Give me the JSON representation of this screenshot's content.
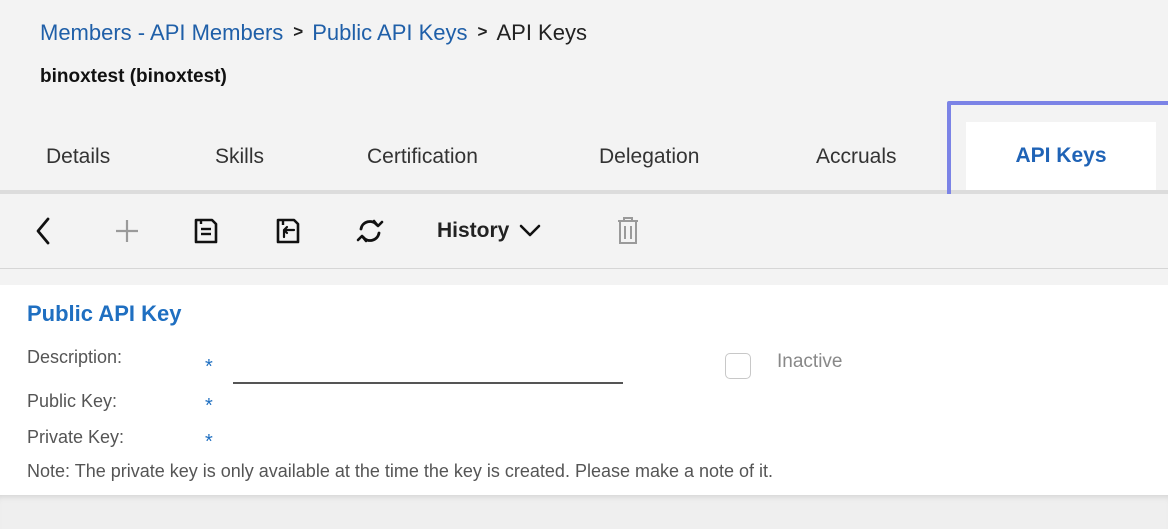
{
  "breadcrumb": {
    "items": [
      "Members - API Members",
      "Public API Keys"
    ],
    "current": "API Keys",
    "separator": ">"
  },
  "record_title": "binoxtest (binoxtest)",
  "tabs": [
    {
      "label": "Details"
    },
    {
      "label": "Skills"
    },
    {
      "label": "Certification"
    },
    {
      "label": "Delegation"
    },
    {
      "label": "Accruals"
    },
    {
      "label": "API Keys",
      "active": true
    }
  ],
  "toolbar": {
    "history_label": "History",
    "icons": [
      "back-icon",
      "add-icon",
      "save-icon",
      "save-and-return-icon",
      "refresh-icon",
      "chevron-down-icon",
      "delete-icon"
    ]
  },
  "form": {
    "section_title": "Public API Key",
    "description_label": "Description:",
    "public_key_label": "Public Key:",
    "private_key_label": "Private Key:",
    "required_marker": "*",
    "description_value": "",
    "inactive_label": "Inactive",
    "inactive_checked": false,
    "note": "Note: The private key is only available at the time the key is created. Please make a note of it."
  },
  "colors": {
    "link": "#1f5fa8",
    "accent": "#1f6fc1",
    "highlight_border": "#7b83e6",
    "background": "#f3f3f3"
  }
}
